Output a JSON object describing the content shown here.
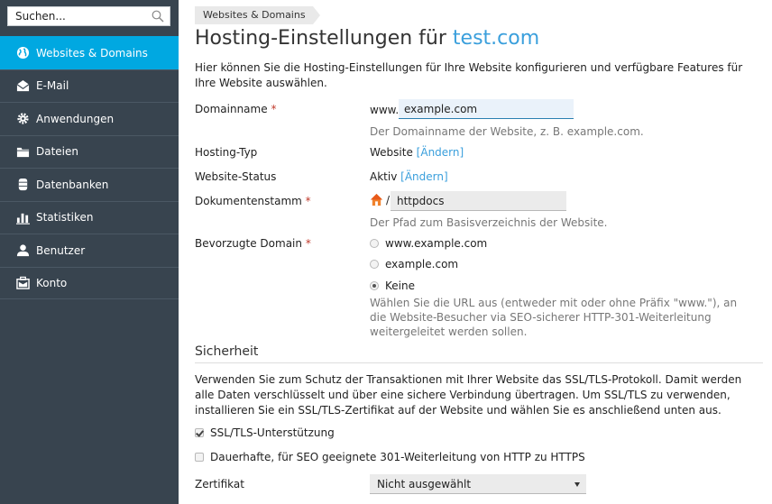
{
  "sidebar": {
    "search_placeholder": "Suchen...",
    "items": [
      {
        "label": "Websites & Domains",
        "icon": "globe-icon",
        "active": true
      },
      {
        "label": "E-Mail",
        "icon": "envelope-icon",
        "active": false
      },
      {
        "label": "Anwendungen",
        "icon": "gear-icon",
        "active": false
      },
      {
        "label": "Dateien",
        "icon": "folder-icon",
        "active": false
      },
      {
        "label": "Datenbanken",
        "icon": "database-icon",
        "active": false
      },
      {
        "label": "Statistiken",
        "icon": "bar-chart-icon",
        "active": false
      },
      {
        "label": "Benutzer",
        "icon": "user-icon",
        "active": false
      },
      {
        "label": "Konto",
        "icon": "briefcase-icon",
        "active": false
      }
    ]
  },
  "breadcrumb": "Websites & Domains",
  "page": {
    "title_prefix": "Hosting-Einstellungen für ",
    "title_domain": "test.com",
    "intro": "Hier können Sie die Hosting-Einstellungen für Ihre Website konfigurieren und verfügbare Features für Ihre Website auswählen."
  },
  "form": {
    "domain": {
      "label": "Domainname",
      "required_mark": "*",
      "prefix": "www.",
      "value": "example.com",
      "hint": "Der Domainname der Website, z. B. example.com."
    },
    "hosting_type": {
      "label": "Hosting-Typ",
      "value": "Website",
      "change_link": "[Ändern]"
    },
    "status": {
      "label": "Website-Status",
      "value": "Aktiv",
      "change_link": "[Ändern]"
    },
    "docroot": {
      "label": "Dokumentenstamm",
      "required_mark": "*",
      "separator": "/",
      "value": "httpdocs",
      "hint": "Der Pfad zum Basisverzeichnis der Website."
    },
    "preferred_domain": {
      "label": "Bevorzugte Domain",
      "required_mark": "*",
      "options": [
        {
          "label": "www.example.com",
          "checked": false
        },
        {
          "label": "example.com",
          "checked": false
        },
        {
          "label": "Keine",
          "checked": true
        }
      ],
      "hint": "Wählen Sie die URL aus (entweder mit oder ohne Präfix \"www.\"), an die Website-Besucher via SEO-sicherer HTTP-301-Weiterleitung weitergeleitet werden sollen."
    }
  },
  "security": {
    "title": "Sicherheit",
    "description": "Verwenden Sie zum Schutz der Transaktionen mit Ihrer Website das SSL/TLS-Protokoll. Damit werden alle Daten verschlüsselt und über eine sichere Verbindung übertragen. Um SSL/TLS zu verwenden, installieren Sie ein SSL/TLS-Zertifikat auf der Website und wählen Sie es anschließend unten aus.",
    "ssl_support": {
      "label": "SSL/TLS-Unterstützung",
      "checked": true
    },
    "https_redirect": {
      "label": "Dauerhafte, für SEO geeignete 301-Weiterleitung von HTTP zu HTTPS",
      "checked": false
    },
    "certificate": {
      "label": "Zertifikat",
      "selected": "Nicht ausgewählt"
    }
  },
  "colors": {
    "sidebar_bg": "#38444f",
    "active_item": "#00a8e1",
    "link": "#3a9fdc",
    "required": "#c0392b"
  }
}
